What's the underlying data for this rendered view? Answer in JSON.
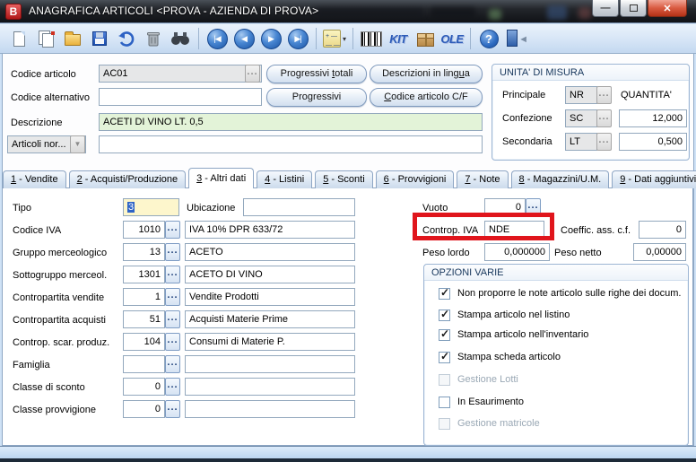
{
  "window": {
    "title": "ANAGRAFICA ARTICOLI <PROVA - AZIENDA DI PROVA>",
    "app_icon_text": "B"
  },
  "toolbar": {
    "kit_label": "KIT",
    "ole_label": "OLE",
    "icons": [
      "new-document",
      "duplicate-document",
      "open-folder",
      "save",
      "undo",
      "delete",
      "find",
      "nav-first",
      "nav-previous",
      "nav-next",
      "nav-last",
      "list-options",
      "barcode",
      "kit",
      "package",
      "ole",
      "help",
      "exit"
    ]
  },
  "header_form": {
    "codice_articolo": {
      "label": "Codice articolo",
      "value": "AC01"
    },
    "codice_alternativo": {
      "label": "Codice alternativo",
      "value": ""
    },
    "descrizione": {
      "label": "Descrizione",
      "value": "ACETI DI VINO LT. 0,5"
    },
    "categoria": {
      "value": "Articoli nor...",
      "desc": ""
    },
    "buttons": {
      "progressivi_totali": {
        "pre": "Progressivi ",
        "accel": "t",
        "post": "otali"
      },
      "descrizioni_lingua": {
        "pre": "Descrizioni in ling",
        "accel": "u",
        "post": "a"
      },
      "progressivi": {
        "pre": "Progressivi",
        "accel": "",
        "post": ""
      },
      "codice_cf": {
        "pre": "",
        "accel": "C",
        "post": "odice articolo C/F"
      }
    }
  },
  "unita_misura": {
    "title": "UNITA' DI MISURA",
    "qty_header": "QUANTITA'",
    "rows": [
      {
        "label": "Principale",
        "um": "NR",
        "qty": ""
      },
      {
        "label": "Confezione",
        "um": "SC",
        "qty": "12,000"
      },
      {
        "label": "Secondaria",
        "um": "LT",
        "qty": "0,500"
      }
    ]
  },
  "tabs": [
    {
      "num": "1",
      "rest": " - Vendite",
      "active": false
    },
    {
      "num": "2",
      "rest": " - Acquisti/Produzione",
      "active": false
    },
    {
      "num": "3",
      "rest": " - Altri dati",
      "active": true
    },
    {
      "num": "4",
      "rest": " - Listini",
      "active": false
    },
    {
      "num": "5",
      "rest": " - Sconti",
      "active": false
    },
    {
      "num": "6",
      "rest": " - Provvigioni",
      "active": false
    },
    {
      "num": "7",
      "rest": " - Note",
      "active": false
    },
    {
      "num": "8",
      "rest": " - Magazzini/U.M.",
      "active": false
    },
    {
      "num": "9",
      "rest": " - Dati aggiuntivi",
      "active": false
    }
  ],
  "altri_dati": {
    "tipo": {
      "label": "Tipo",
      "value": "3"
    },
    "ubicazione": {
      "label": "Ubicazione",
      "value": ""
    },
    "rows": [
      {
        "label": "Codice IVA",
        "code": "1010",
        "desc": "IVA 10% DPR 633/72"
      },
      {
        "label": "Gruppo merceologico",
        "code": "13",
        "desc": "ACETO"
      },
      {
        "label": "Sottogruppo merceol.",
        "code": "1301",
        "desc": "ACETO DI VINO"
      },
      {
        "label": "Contropartita vendite",
        "code": "1",
        "desc": "Vendite Prodotti"
      },
      {
        "label": "Contropartita acquisti",
        "code": "51",
        "desc": "Acquisti Materie Prime"
      },
      {
        "label": "Controp. scar. produz.",
        "code": "104",
        "desc": "Consumi di Materie P."
      },
      {
        "label": "Famiglia",
        "code": "",
        "desc": ""
      },
      {
        "label": "Classe di sconto",
        "code": "0",
        "desc": ""
      },
      {
        "label": "Classe provvigione",
        "code": "0",
        "desc": ""
      }
    ],
    "vuoto": {
      "label": "Vuoto",
      "value": "0"
    },
    "controp_iva": {
      "label": "Controp. IVA",
      "value": "NDE"
    },
    "coeff": {
      "label": "Coeffic. ass. c.f.",
      "value": "0"
    },
    "peso_lordo": {
      "label": "Peso lordo",
      "value": "0,000000"
    },
    "peso_netto": {
      "label": "Peso netto",
      "value": "0,00000"
    }
  },
  "opzioni_varie": {
    "title": "OPZIONI VARIE",
    "options": [
      {
        "label": "Non proporre le note articolo sulle righe dei docum.",
        "checked": true,
        "enabled": true
      },
      {
        "label": "Stampa articolo nel listino",
        "checked": true,
        "enabled": true
      },
      {
        "label": "Stampa articolo nell'inventario",
        "checked": true,
        "enabled": true
      },
      {
        "label": "Stampa scheda articolo",
        "checked": true,
        "enabled": true
      },
      {
        "label": "Gestione Lotti",
        "checked": false,
        "enabled": false
      },
      {
        "label": "In Esaurimento",
        "checked": false,
        "enabled": true
      },
      {
        "label": "Gestione matricole",
        "checked": false,
        "enabled": false
      }
    ]
  },
  "annotation": {
    "target": "controp-iva-field",
    "color": "#e0151c"
  }
}
